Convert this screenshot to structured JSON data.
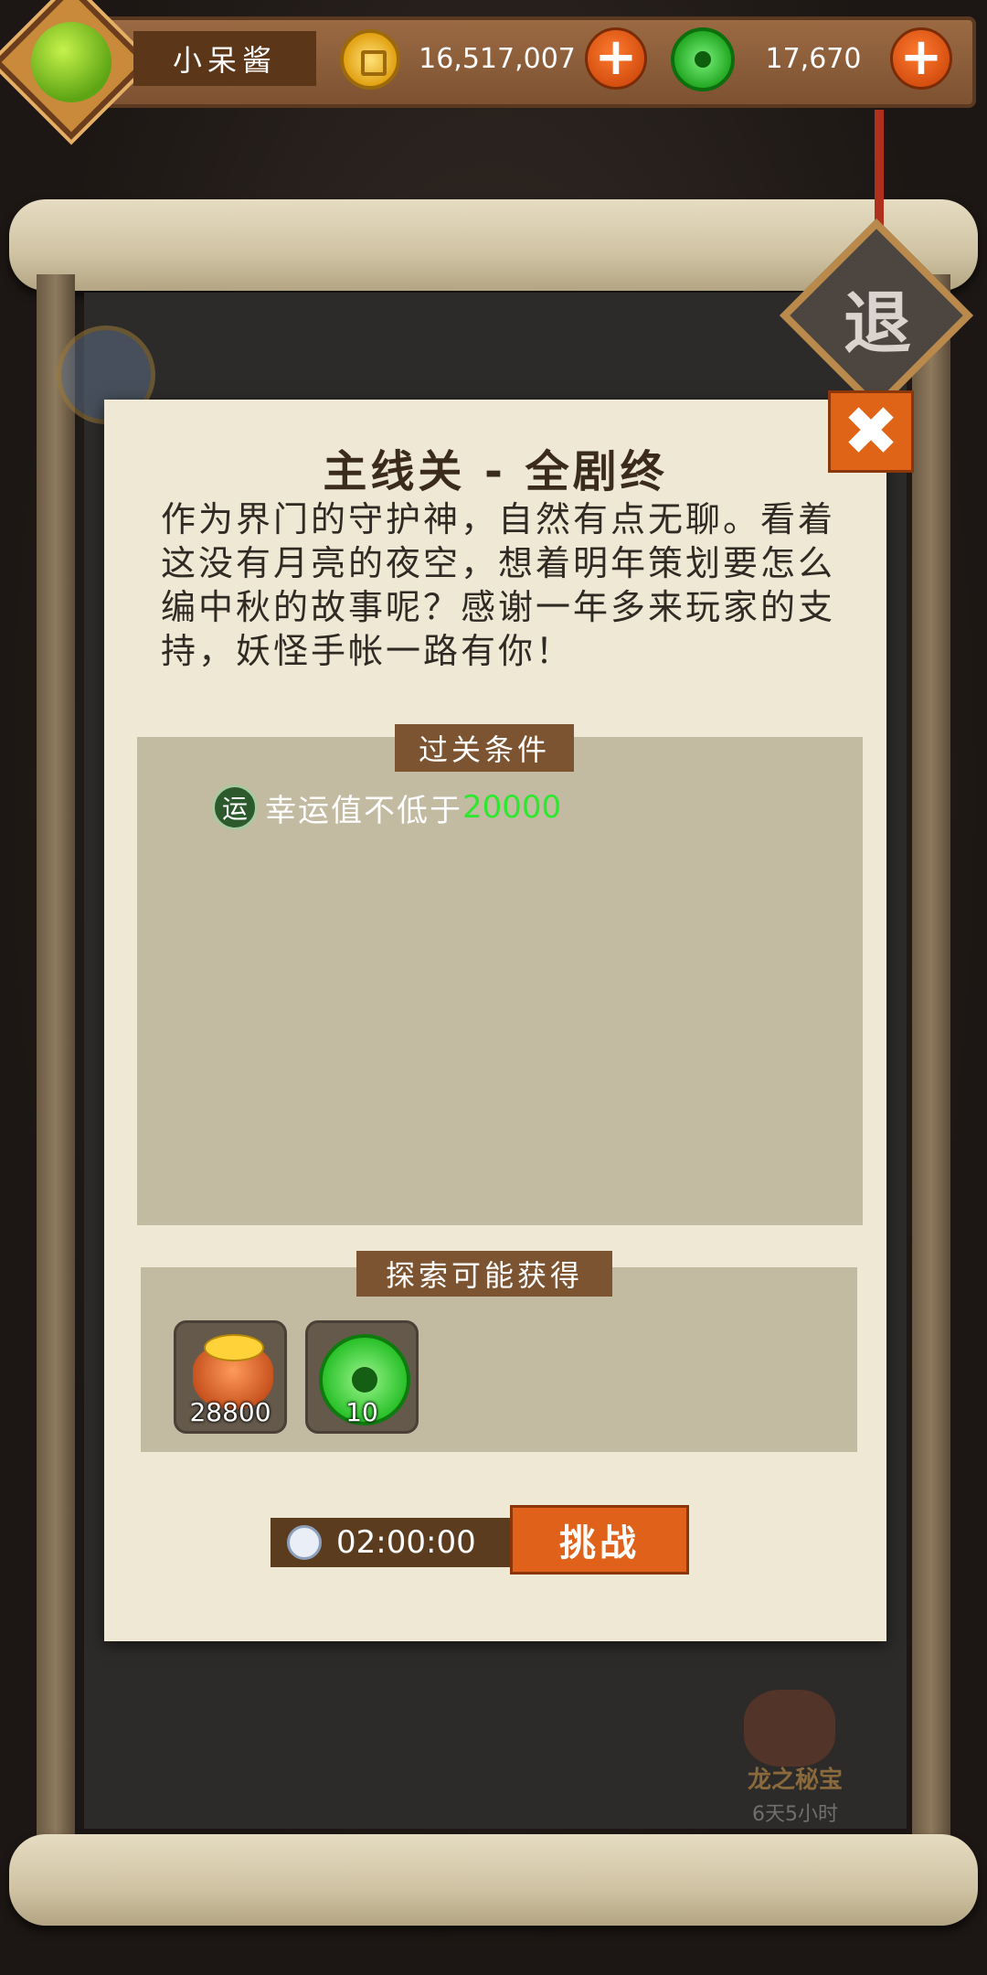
{
  "header": {
    "player_name": "小呆酱",
    "coins": "16,517,007",
    "jade": "17,670",
    "exit_label": "退"
  },
  "dialog": {
    "title": "主线关 - 全剧终",
    "story": "作为界门的守护神，自然有点无聊。看着这没有月亮的夜空，想着明年策划要怎么编中秋的故事呢？感谢一年多来玩家的支持，妖怪手帐一路有你！",
    "conditions_tab": "过关条件",
    "condition_icon_label": "运",
    "condition_text": "幸运值不低于",
    "condition_value": "20000",
    "rewards_tab": "探索可能获得",
    "rewards": [
      {
        "icon": "gold-bag-icon",
        "count": "28800"
      },
      {
        "icon": "jade-ring-icon",
        "count": "10"
      }
    ],
    "timer": "02:00:00",
    "challenge_label": "挑战",
    "close_label": "✖"
  },
  "event": {
    "title": "龙之秘宝",
    "time_left": "6天5小时"
  }
}
